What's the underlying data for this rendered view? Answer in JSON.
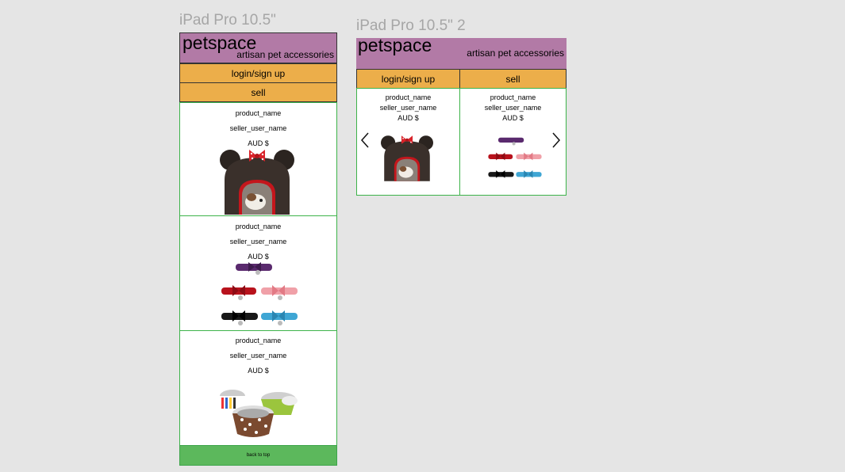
{
  "frames": [
    {
      "title": "iPad Pro 10.5\""
    },
    {
      "title": "iPad Pro 10.5\" 2"
    }
  ],
  "header": {
    "brand": "petspace",
    "tagline": "artisan pet accessories"
  },
  "nav": {
    "login": "login/sign up",
    "sell": "sell"
  },
  "product": {
    "name": "product_name",
    "seller": "seller_user_name",
    "price": "AUD $"
  },
  "footer": {
    "back_to_top": "back to top"
  },
  "carousel": {
    "prev_icon": "chevron-left-icon",
    "next_icon": "chevron-right-icon"
  },
  "colors": {
    "header": "#b27aa6",
    "nav": "#ecae4a",
    "card_border": "#3db34a",
    "footer": "#5cb85c"
  }
}
